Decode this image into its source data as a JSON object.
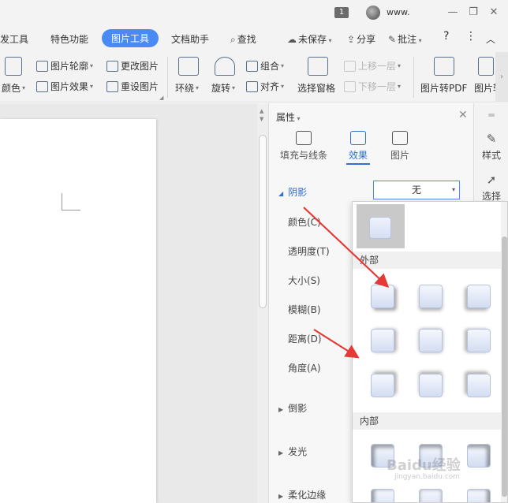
{
  "titlebar": {
    "badge": "1",
    "user": "www.",
    "min": "—",
    "restore": "❐",
    "close": "✕"
  },
  "menu": {
    "tabs": [
      "发工具",
      "特色功能",
      "图片工具",
      "文档助手",
      "查找"
    ],
    "active": "图片工具",
    "unsaved": "未保存",
    "share": "分享",
    "annotate": "批注",
    "help": "?",
    "more": "⋮",
    "collapse": "︿"
  },
  "ribbon": {
    "color": "颜色",
    "outline": "图片轮廓",
    "effect": "图片效果",
    "change": "更改图片",
    "reset": "重设图片",
    "wrap": "环绕",
    "rotate": "旋转",
    "group": "组合",
    "align": "对齐",
    "selpane": "选择窗格",
    "bringup": "上移一层",
    "senddown": "下移一层",
    "topdf": "图片转PDF",
    "more": "图片转"
  },
  "panel": {
    "title": "属性",
    "tabs": [
      {
        "label": "填充与线条"
      },
      {
        "label": "效果"
      },
      {
        "label": "图片"
      }
    ],
    "shadow_label": "阴影",
    "shadow_value": "无",
    "props": [
      "颜色(C)",
      "透明度(T)",
      "大小(S)",
      "模糊(B)",
      "距离(D)",
      "角度(A)"
    ],
    "sections": [
      "倒影",
      "发光",
      "柔化边缘"
    ]
  },
  "popup": {
    "outer": "外部",
    "inner": "内部"
  },
  "rail": {
    "style": "样式",
    "select": "选择"
  },
  "watermark": {
    "brand": "Baidu经验",
    "url": "jingyan.baidu.com"
  },
  "colors": {
    "accent": "#4a8af4",
    "arrow": "#e53935"
  }
}
